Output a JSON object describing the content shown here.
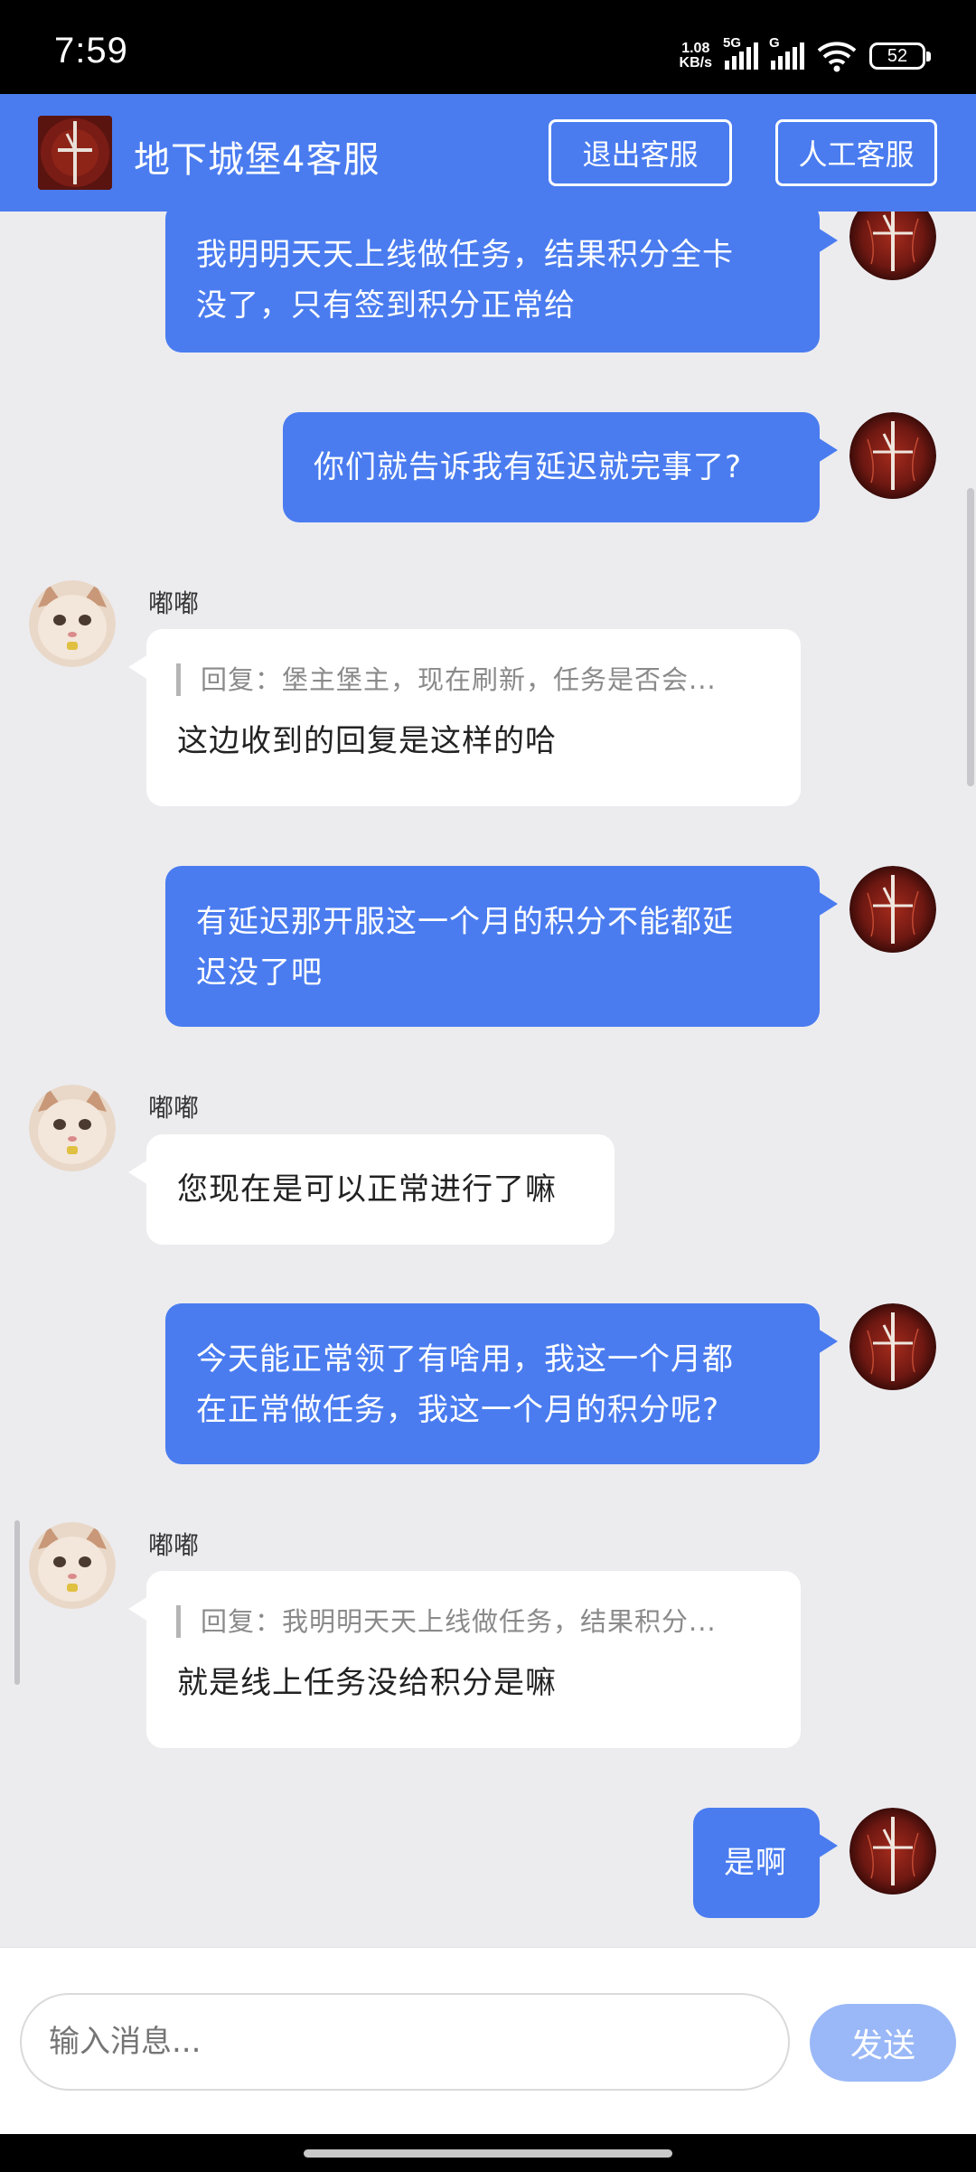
{
  "status_bar": {
    "time": "7:59",
    "net_speed_value": "1.08",
    "net_speed_unit": "KB/s",
    "signal1_label": "5G",
    "signal2_label": "G",
    "battery": "52"
  },
  "header": {
    "title": "地下城堡4客服",
    "exit_button": "退出客服",
    "human_button": "人工客服",
    "accent": "#4a7cf0"
  },
  "messages": [
    {
      "side": "me",
      "text_lines": [
        "我明明天天上线做任务，结果积分全卡",
        "没了，只有签到积分正常给"
      ]
    },
    {
      "side": "me",
      "text_lines": [
        "你们就告诉我有延迟就完事了?"
      ]
    },
    {
      "side": "them",
      "sender": "嘟嘟",
      "quote": "回复：堡主堡主，现在刷新，任务是否会...",
      "text_lines": [
        "这边收到的回复是这样的哈"
      ]
    },
    {
      "side": "me",
      "text_lines": [
        "有延迟那开服这一个月的积分不能都延",
        "迟没了吧"
      ]
    },
    {
      "side": "them",
      "sender": "嘟嘟",
      "text_lines": [
        "您现在是可以正常进行了嘛"
      ]
    },
    {
      "side": "me",
      "text_lines": [
        "今天能正常领了有啥用，我这一个月都",
        "在正常做任务，我这一个月的积分呢?"
      ]
    },
    {
      "side": "them",
      "sender": "嘟嘟",
      "quote": "回复：我明明天天上线做任务，结果积分...",
      "text_lines": [
        "就是线上任务没给积分是嘛"
      ]
    },
    {
      "side": "me",
      "text_lines": [
        "是啊"
      ]
    }
  ],
  "input": {
    "placeholder": "输入消息...",
    "send_label": "发送"
  }
}
